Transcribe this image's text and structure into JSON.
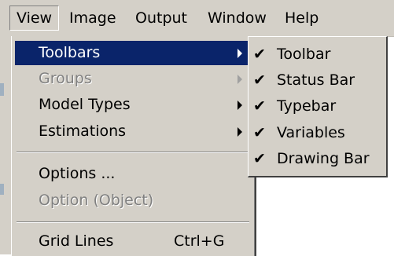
{
  "menubar": {
    "items": [
      {
        "label": "View"
      },
      {
        "label": "Image"
      },
      {
        "label": "Output"
      },
      {
        "label": "Window"
      },
      {
        "label": "Help"
      }
    ]
  },
  "view_menu": {
    "items": [
      {
        "label": "Toolbars"
      },
      {
        "label": "Groups"
      },
      {
        "label": "Model Types"
      },
      {
        "label": "Estimations"
      },
      {
        "label": "Options ..."
      },
      {
        "label": "Option (Object)"
      },
      {
        "label": "Grid Lines",
        "shortcut": "Ctrl+G"
      }
    ]
  },
  "toolbars_submenu": {
    "items": [
      {
        "label": "Toolbar",
        "checked": true
      },
      {
        "label": "Status Bar",
        "checked": true
      },
      {
        "label": "Typebar",
        "checked": true
      },
      {
        "label": "Variables",
        "checked": true
      },
      {
        "label": "Drawing Bar",
        "checked": true
      }
    ],
    "check_glyph": "✔"
  },
  "colors": {
    "menu_face": "#d4d0c8",
    "highlight": "#0a246a",
    "disabled_text": "#808080"
  },
  "icons": {
    "submenu_arrow": "submenu-arrow-icon",
    "check": "checkmark-icon"
  }
}
